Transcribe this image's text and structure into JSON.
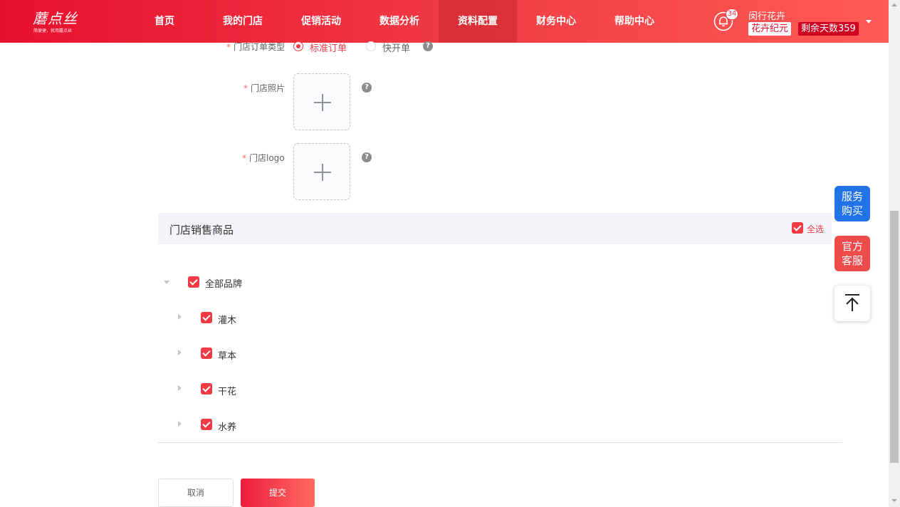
{
  "header": {
    "logo_text": "蘑点丝",
    "logo_slogan": "简便捷，就用蘑点丝",
    "nav": [
      {
        "label": "首页",
        "active": false
      },
      {
        "label": "我的门店",
        "active": false
      },
      {
        "label": "促销活动",
        "active": false
      },
      {
        "label": "数据分析",
        "active": false
      },
      {
        "label": "资料配置",
        "active": true
      },
      {
        "label": "财务中心",
        "active": false
      },
      {
        "label": "帮助中心",
        "active": false
      }
    ],
    "notification_count": "34",
    "user_name": "闵行花卉",
    "brand_tag": "花卉纪元",
    "remaining_days": "剩余天数359"
  },
  "form": {
    "order_type_label": "门店订单类型",
    "order_type_options": [
      {
        "label": "标准订单",
        "selected": true
      },
      {
        "label": "快开单",
        "selected": false
      }
    ],
    "photo_label": "门店照片",
    "logo_label": "门店logo",
    "help_glyph": "?"
  },
  "products": {
    "section_title": "门店销售商品",
    "select_all_label": "全选",
    "select_all_checked": true,
    "tree": {
      "label": "全部品牌",
      "checked": true,
      "expanded": true,
      "children": [
        {
          "label": "灌木",
          "checked": true
        },
        {
          "label": "草本",
          "checked": true
        },
        {
          "label": "干花",
          "checked": true
        },
        {
          "label": "水养",
          "checked": true
        }
      ]
    }
  },
  "actions": {
    "cancel_label": "取消",
    "submit_label": "提交"
  },
  "floating": {
    "service_buy": "服务购买",
    "service_line1": "服务",
    "service_line2": "购买",
    "support_line1": "官方",
    "support_line2": "客服",
    "back_to_top": "back-to-top-icon"
  },
  "colors": {
    "brand_red": "#f03a44",
    "service_blue": "#2272e8",
    "support_red": "#f04b4b"
  }
}
